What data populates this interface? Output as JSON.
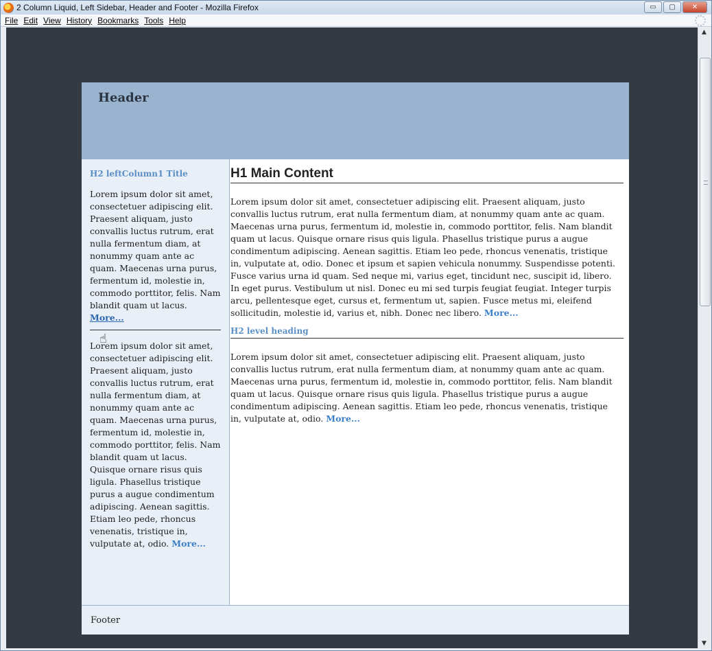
{
  "window": {
    "title": "2 Column Liquid, Left Sidebar, Header and Footer - Mozilla Firefox",
    "controls": {
      "minimize": "▭",
      "maximize": "▢",
      "close": "✕"
    }
  },
  "menu": {
    "items": [
      "File",
      "Edit",
      "View",
      "History",
      "Bookmarks",
      "Tools",
      "Help"
    ]
  },
  "page": {
    "header_title": "Header",
    "left": {
      "h2": "H2 leftColumn1 Title",
      "p1": "Lorem ipsum dolor sit amet, consectetuer adipiscing elit. Praesent aliquam, justo convallis luctus rutrum, erat nulla fermentum diam, at nonummy quam ante ac quam. Maecenas urna purus, fermentum id, molestie in, commodo porttitor, felis. Nam blandit quam ut lacus. ",
      "p1_more": "More...",
      "p2": "Lorem ipsum dolor sit amet, consectetuer adipiscing elit. Praesent aliquam, justo convallis luctus rutrum, erat nulla fermentum diam, at nonummy quam ante ac quam. Maecenas urna purus, fermentum id, molestie in, commodo porttitor, felis. Nam blandit quam ut lacus. Quisque ornare risus quis ligula. Phasellus tristique purus a augue condimentum adipiscing. Aenean sagittis. Etiam leo pede, rhoncus venenatis, tristique in, vulputate at, odio. ",
      "p2_more": "More..."
    },
    "main": {
      "h1": "H1 Main Content",
      "p1": "Lorem ipsum dolor sit amet, consectetuer adipiscing elit. Praesent aliquam, justo convallis luctus rutrum, erat nulla fermentum diam, at nonummy quam ante ac quam. Maecenas urna purus, fermentum id, molestie in, commodo porttitor, felis. Nam blandit quam ut lacus. Quisque ornare risus quis ligula. Phasellus tristique purus a augue condimentum adipiscing. Aenean sagittis. Etiam leo pede, rhoncus venenatis, tristique in, vulputate at, odio. Donec et ipsum et sapien vehicula nonummy. Suspendisse potenti. Fusce varius urna id quam. Sed neque mi, varius eget, tincidunt nec, suscipit id, libero. In eget purus. Vestibulum ut nisl. Donec eu mi sed turpis feugiat feugiat. Integer turpis arcu, pellentesque eget, cursus et, fermentum ut, sapien. Fusce metus mi, eleifend sollicitudin, molestie id, varius et, nibh. Donec nec libero. ",
      "p1_more": "More...",
      "h2": "H2 level heading",
      "p2": "Lorem ipsum dolor sit amet, consectetuer adipiscing elit. Praesent aliquam, justo convallis luctus rutrum, erat nulla fermentum diam, at nonummy quam ante ac quam. Maecenas urna purus, fermentum id, molestie in, commodo porttitor, felis. Nam blandit quam ut lacus. Quisque ornare risus quis ligula. Phasellus tristique purus a augue condimentum adipiscing. Aenean sagittis. Etiam leo pede, rhoncus venenatis, tristique in, vulputate at, odio. ",
      "p2_more": "More..."
    },
    "footer": "Footer"
  },
  "colors": {
    "viewport_bg": "#333a42",
    "header_bg": "#9ab4d0",
    "sidebar_bg": "#e9eff6",
    "link": "#3a7fc8"
  },
  "icons": {
    "app": "firefox-icon",
    "cursor": "hand-pointer-icon"
  }
}
